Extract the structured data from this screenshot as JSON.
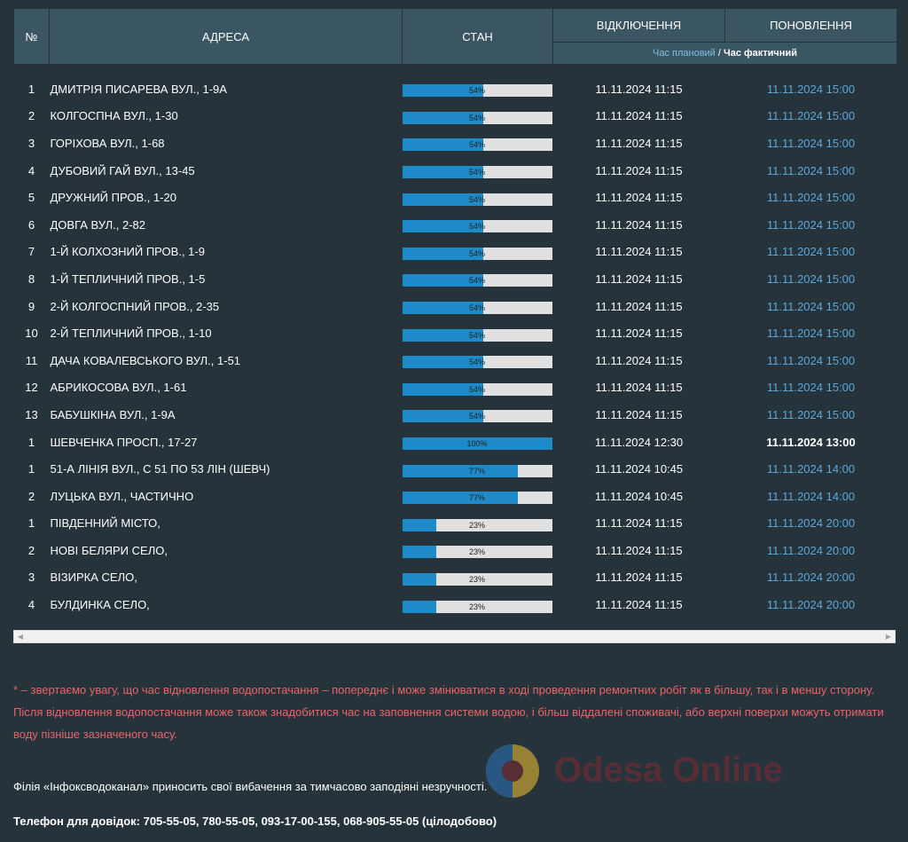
{
  "header": {
    "num": "№",
    "address": "АДРЕСА",
    "state": "СТАН",
    "off": "ВІДКЛЮЧЕННЯ",
    "update": "ПОНОВЛЕННЯ",
    "legend_planned": "Час плановий",
    "legend_sep": " / ",
    "legend_actual": "Час фактичний"
  },
  "rows": [
    {
      "num": "1",
      "address": "ДМИТРІЯ ПИСАРЕВА ВУЛ., 1-9А",
      "progress": 54,
      "progress_label": "54%",
      "off": "11.11.2024 11:15",
      "update": "11.11.2024 15:00",
      "actual": false
    },
    {
      "num": "2",
      "address": "КОЛГОСПНА ВУЛ., 1-30",
      "progress": 54,
      "progress_label": "54%",
      "off": "11.11.2024 11:15",
      "update": "11.11.2024 15:00",
      "actual": false
    },
    {
      "num": "3",
      "address": "ГОРІХОВА ВУЛ., 1-68",
      "progress": 54,
      "progress_label": "54%",
      "off": "11.11.2024 11:15",
      "update": "11.11.2024 15:00",
      "actual": false
    },
    {
      "num": "4",
      "address": "ДУБОВИЙ ГАЙ ВУЛ., 13-45",
      "progress": 54,
      "progress_label": "54%",
      "off": "11.11.2024 11:15",
      "update": "11.11.2024 15:00",
      "actual": false
    },
    {
      "num": "5",
      "address": "ДРУЖНИЙ ПРОВ., 1-20",
      "progress": 54,
      "progress_label": "54%",
      "off": "11.11.2024 11:15",
      "update": "11.11.2024 15:00",
      "actual": false
    },
    {
      "num": "6",
      "address": "ДОВГА ВУЛ., 2-82",
      "progress": 54,
      "progress_label": "54%",
      "off": "11.11.2024 11:15",
      "update": "11.11.2024 15:00",
      "actual": false
    },
    {
      "num": "7",
      "address": "1-Й КОЛХОЗНИЙ ПРОВ., 1-9",
      "progress": 54,
      "progress_label": "54%",
      "off": "11.11.2024 11:15",
      "update": "11.11.2024 15:00",
      "actual": false
    },
    {
      "num": "8",
      "address": "1-Й ТЕПЛИЧНИЙ ПРОВ., 1-5",
      "progress": 54,
      "progress_label": "54%",
      "off": "11.11.2024 11:15",
      "update": "11.11.2024 15:00",
      "actual": false
    },
    {
      "num": "9",
      "address": "2-Й КОЛГОСПНИЙ ПРОВ., 2-35",
      "progress": 54,
      "progress_label": "54%",
      "off": "11.11.2024 11:15",
      "update": "11.11.2024 15:00",
      "actual": false
    },
    {
      "num": "10",
      "address": "2-Й ТЕПЛИЧНИЙ ПРОВ., 1-10",
      "progress": 54,
      "progress_label": "54%",
      "off": "11.11.2024 11:15",
      "update": "11.11.2024 15:00",
      "actual": false
    },
    {
      "num": "11",
      "address": "ДАЧА КОВАЛЕВСЬКОГО ВУЛ., 1-51",
      "progress": 54,
      "progress_label": "54%",
      "off": "11.11.2024 11:15",
      "update": "11.11.2024 15:00",
      "actual": false
    },
    {
      "num": "12",
      "address": "АБРИКОСОВА ВУЛ., 1-61",
      "progress": 54,
      "progress_label": "54%",
      "off": "11.11.2024 11:15",
      "update": "11.11.2024 15:00",
      "actual": false
    },
    {
      "num": "13",
      "address": "БАБУШКІНА ВУЛ., 1-9А",
      "progress": 54,
      "progress_label": "54%",
      "off": "11.11.2024 11:15",
      "update": "11.11.2024 15:00",
      "actual": false
    },
    {
      "num": "1",
      "address": "ШЕВЧЕНКА ПРОСП., 17-27",
      "progress": 100,
      "progress_label": "100%",
      "off": "11.11.2024 12:30",
      "update": "11.11.2024 13:00",
      "actual": true
    },
    {
      "num": "1",
      "address": "51-А ЛІНІЯ ВУЛ., С 51 ПО 53 ЛІН (ШЕВЧ)",
      "progress": 77,
      "progress_label": "77%",
      "off": "11.11.2024 10:45",
      "update": "11.11.2024 14:00",
      "actual": false
    },
    {
      "num": "2",
      "address": "ЛУЦЬКА ВУЛ., ЧАСТИЧНО",
      "progress": 77,
      "progress_label": "77%",
      "off": "11.11.2024 10:45",
      "update": "11.11.2024 14:00",
      "actual": false
    },
    {
      "num": "1",
      "address": "ПІВДЕННИЙ МІСТО,",
      "progress": 23,
      "progress_label": "23%",
      "off": "11.11.2024 11:15",
      "update": "11.11.2024 20:00",
      "actual": false
    },
    {
      "num": "2",
      "address": "НОВІ БЕЛЯРИ СЕЛО,",
      "progress": 23,
      "progress_label": "23%",
      "off": "11.11.2024 11:15",
      "update": "11.11.2024 20:00",
      "actual": false
    },
    {
      "num": "3",
      "address": "ВІЗИРКА СЕЛО,",
      "progress": 23,
      "progress_label": "23%",
      "off": "11.11.2024 11:15",
      "update": "11.11.2024 20:00",
      "actual": false
    },
    {
      "num": "4",
      "address": "БУЛДИНКА СЕЛО,",
      "progress": 23,
      "progress_label": "23%",
      "off": "11.11.2024 11:15",
      "update": "11.11.2024 20:00",
      "actual": false
    }
  ],
  "scrollbar": {
    "left_icon": "chevron-left-icon",
    "right_icon": "chevron-right-icon"
  },
  "note": "* – звертаємо увагу, що час відновлення водопостачання – попереднє і може змінюватися в ході проведення ремонтних робіт як в більшу, так і в меншу сторону. Після відновлення водопостачання може також знадобитися час на заповнення системи водою, і більш віддалені споживачі, або верхні поверхи можуть отримати воду пізніше зазначеного часу.",
  "apology": "Філія «Інфоксводоканал» приносить свої вибачення за тимчасово заподіяні незручності.",
  "phones": "Телефон для довідок: 705-55-05, 780-55-05, 093-17-00-155, 068-905-55-05 (цілодобово)",
  "watermark": {
    "text": "Odesa Online"
  },
  "colors": {
    "background": "#26333b",
    "header": "#3a5662",
    "bar_fill": "#1e8ac8",
    "bar_track": "#e0e0e0",
    "planned": "#5aa8dc",
    "note": "#e8636a"
  }
}
